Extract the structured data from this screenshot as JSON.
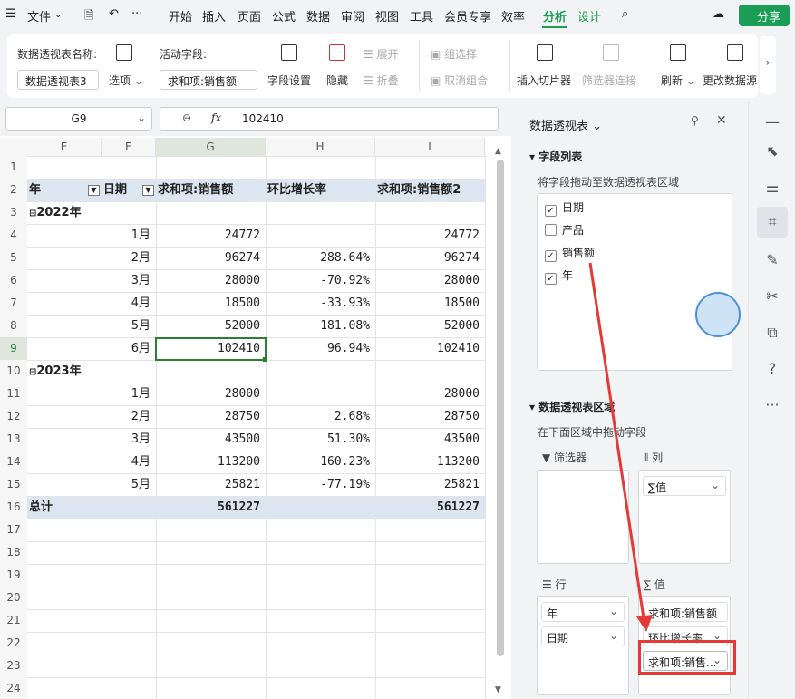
{
  "menu": {
    "hamburger": "☰",
    "file": "文件",
    "more": "···",
    "items": [
      "开始",
      "插入",
      "页面",
      "公式",
      "数据",
      "审阅",
      "视图",
      "工具",
      "会员专享",
      "效率"
    ],
    "active": "分析",
    "design": "设计",
    "share": "分享"
  },
  "ribbon": {
    "pt_name_label": "数据透视表名称:",
    "pt_name_value": "数据透视表3",
    "options": "选项",
    "active_field_label": "活动字段:",
    "active_field_value": "求和项:销售额",
    "field_settings": "字段设置",
    "hide": "隐藏",
    "expand": "展开",
    "collapse": "折叠",
    "group_select": "组选择",
    "ungroup": "取消组合",
    "insert_slicer": "插入切片器",
    "filter_conn": "筛选器连接",
    "refresh": "刷新",
    "change_source": "更改数据源"
  },
  "formula": {
    "cell": "G9",
    "fx": "fx",
    "value": "102410"
  },
  "sheet": {
    "cols": [
      "E",
      "F",
      "G",
      "H",
      "I"
    ],
    "rows": [
      "1",
      "2",
      "3",
      "4",
      "5",
      "6",
      "7",
      "8",
      "9",
      "10",
      "11",
      "12",
      "13",
      "14",
      "15",
      "16",
      "17",
      "18",
      "19",
      "20",
      "21",
      "22",
      "23",
      "24"
    ],
    "header": {
      "e": "年",
      "f": "日期",
      "g": "求和项:销售额",
      "h": "环比增长率",
      "i": "求和项:销售额2"
    },
    "year1": "2022年",
    "year2": "2023年",
    "data1": [
      {
        "m": "1月",
        "g": "24772",
        "h": "",
        "i": "24772"
      },
      {
        "m": "2月",
        "g": "96274",
        "h": "288.64%",
        "i": "96274"
      },
      {
        "m": "3月",
        "g": "28000",
        "h": "-70.92%",
        "i": "28000"
      },
      {
        "m": "4月",
        "g": "18500",
        "h": "-33.93%",
        "i": "18500"
      },
      {
        "m": "5月",
        "g": "52000",
        "h": "181.08%",
        "i": "52000"
      },
      {
        "m": "6月",
        "g": "102410",
        "h": "96.94%",
        "i": "102410"
      }
    ],
    "data2": [
      {
        "m": "1月",
        "g": "28000",
        "h": "",
        "i": "28000"
      },
      {
        "m": "2月",
        "g": "28750",
        "h": "2.68%",
        "i": "28750"
      },
      {
        "m": "3月",
        "g": "43500",
        "h": "51.30%",
        "i": "43500"
      },
      {
        "m": "4月",
        "g": "113200",
        "h": "160.23%",
        "i": "113200"
      },
      {
        "m": "5月",
        "g": "25821",
        "h": "-77.19%",
        "i": "25821"
      }
    ],
    "total": {
      "label": "总计",
      "g": "561227",
      "i": "561227"
    }
  },
  "panel": {
    "title": "数据透视表",
    "field_list": "字段列表",
    "drag_hint": "将字段拖动至数据透视表区域",
    "fields": [
      {
        "name": "日期",
        "checked": true
      },
      {
        "name": "产品",
        "checked": false
      },
      {
        "name": "销售额",
        "checked": true
      },
      {
        "name": "年",
        "checked": true
      }
    ],
    "area_title": "数据透视表区域",
    "area_hint": "在下面区域中拖动字段",
    "filter": "筛选器",
    "columns": "列",
    "rows_label": "行",
    "values": "值",
    "col_items": [
      "∑值"
    ],
    "row_items": [
      "年",
      "日期"
    ],
    "value_items": [
      "求和项:销售额",
      "环比增长率",
      "求和项:销售..."
    ]
  },
  "colors": {
    "accent": "#1a9d54",
    "highlight": "#e53935",
    "header_bg": "#dce6f1"
  }
}
